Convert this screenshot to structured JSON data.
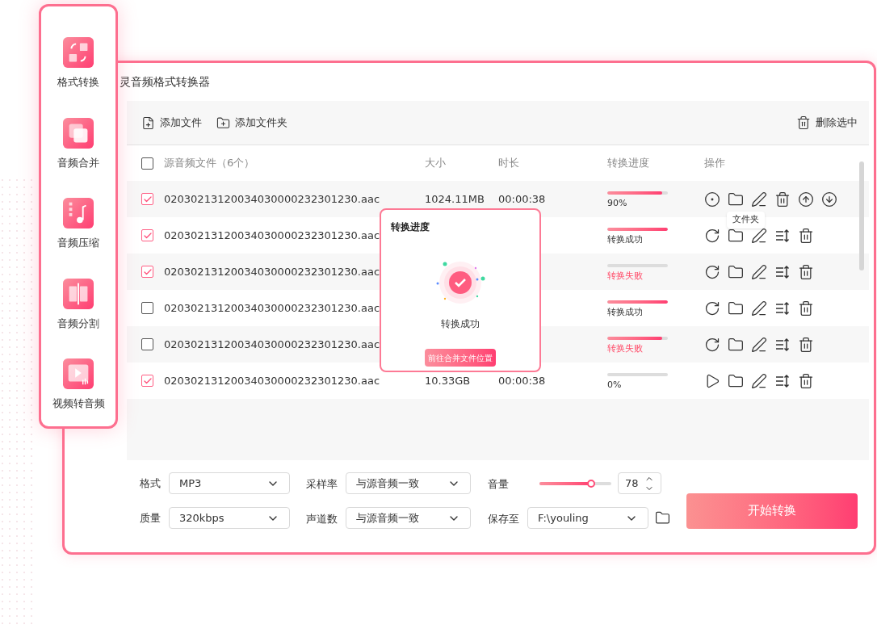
{
  "sidebar": {
    "items": [
      {
        "label": "格式转换",
        "kind": "convert",
        "selected": false
      },
      {
        "label": "音频合并",
        "kind": "merge",
        "selected": false
      },
      {
        "label": "音频压缩",
        "kind": "compress",
        "selected": false
      },
      {
        "label": "音频分割",
        "kind": "split",
        "selected": false
      },
      {
        "label": "视频转音频",
        "kind": "video",
        "selected": false
      }
    ]
  },
  "window": {
    "title": "灵音频格式转换器"
  },
  "toolbar": {
    "add_file": "添加文件",
    "add_folder": "添加文件夹",
    "delete_selected": "删除选中"
  },
  "table": {
    "columns": [
      "源音频文件（6个）",
      "大小",
      "时长",
      "转换进度",
      "操作"
    ],
    "all_checked": false,
    "rows": [
      {
        "checked": true,
        "name": "02030213120034030000232301230.aac",
        "size": "1024.11MB",
        "duration": "00:00:38",
        "level": 0.9,
        "progress_text": "90%",
        "failed": false,
        "actions": [
          {
            "kind": "stop"
          },
          {
            "kind": "folder"
          },
          {
            "kind": "edit"
          },
          {
            "kind": "delete"
          },
          {
            "kind": "up"
          },
          {
            "kind": "down"
          }
        ]
      },
      {
        "checked": true,
        "name": "02030213120034030000232301230.aac",
        "level": 1,
        "progress_text": "转换成功",
        "failed": false,
        "actions": [
          {
            "kind": "retry"
          },
          {
            "kind": "folder"
          },
          {
            "kind": "edit"
          },
          {
            "kind": "sort"
          },
          {
            "kind": "delete"
          }
        ]
      },
      {
        "checked": true,
        "name": "02030213120034030000232301230.aac",
        "level": 0,
        "progress_text": "转换失败",
        "failed": true,
        "actions": [
          {
            "kind": "retry"
          },
          {
            "kind": "folder"
          },
          {
            "kind": "edit"
          },
          {
            "kind": "sort"
          },
          {
            "kind": "delete"
          }
        ]
      },
      {
        "checked": false,
        "name": "02030213120034030000232301230.aac",
        "level": 1,
        "progress_text": "转换成功",
        "failed": false,
        "actions": [
          {
            "kind": "retry"
          },
          {
            "kind": "folder"
          },
          {
            "kind": "edit"
          },
          {
            "kind": "sort"
          },
          {
            "kind": "delete"
          }
        ]
      },
      {
        "checked": false,
        "name": "02030213120034030000232301230.aac",
        "level": 0.9,
        "progress_text": "转换失败",
        "failed": true,
        "actions": [
          {
            "kind": "retry"
          },
          {
            "kind": "folder"
          },
          {
            "kind": "edit"
          },
          {
            "kind": "sort"
          },
          {
            "kind": "delete"
          }
        ]
      },
      {
        "checked": true,
        "name": "02030213120034030000232301230.aac",
        "size": "10.33GB",
        "duration": "00:00:38",
        "level": 0,
        "progress_text": "0%",
        "failed": false,
        "actions": [
          {
            "kind": "play"
          },
          {
            "kind": "folder"
          },
          {
            "kind": "edit"
          },
          {
            "kind": "sort"
          },
          {
            "kind": "delete"
          }
        ]
      }
    ]
  },
  "tooltip": "文件夹",
  "popup": {
    "title": "转换进度",
    "status": "转换成功",
    "button": "前往合并文件位置"
  },
  "settings": {
    "format_label": "格式",
    "format": "MP3",
    "sample_label": "采样率",
    "sample": "与源音频一致",
    "volume_label": "音量",
    "volume": {
      "level": 0.72
    },
    "volume_value": "78",
    "quality_label": "质量",
    "quality": "320kbps",
    "channels_label": "声道数",
    "channels": "与源音频一致",
    "save_label": "保存至",
    "save_path": "F:\\youling"
  },
  "start_button": "开始转换"
}
